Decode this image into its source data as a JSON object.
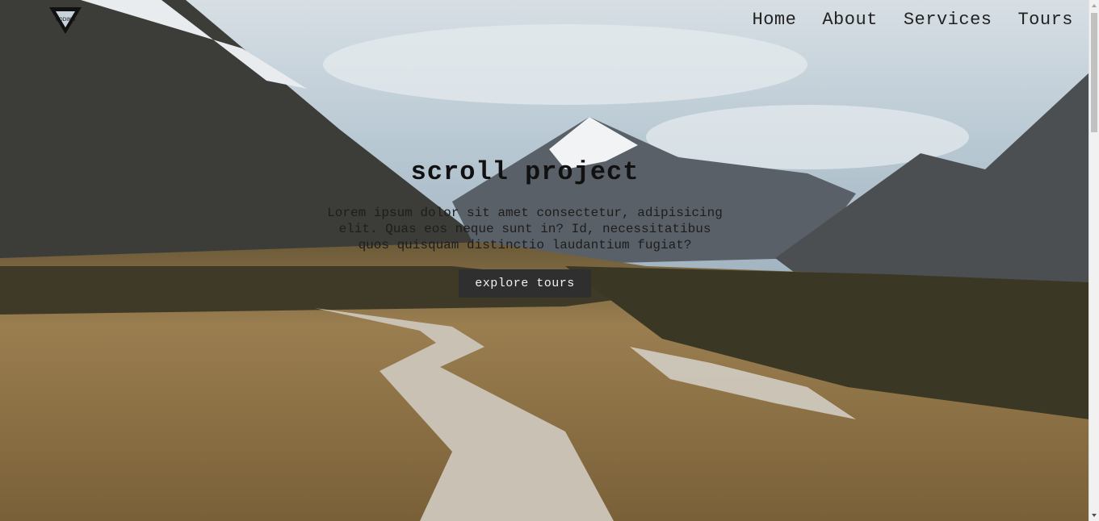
{
  "nav": {
    "logo_icon": "coding-addict-logo",
    "links": [
      {
        "label": "Home"
      },
      {
        "label": "About"
      },
      {
        "label": "Services"
      },
      {
        "label": "Tours"
      }
    ]
  },
  "hero": {
    "background": "mountain-valley-boardwalk-photo",
    "title": "scroll project",
    "text": "Lorem ipsum dolor sit amet consectetur, adipisicing elit. Quas eos neque sunt in? Id, necessitatibus quos quisquam distinctio laudantium fugiat?",
    "button_label": "explore tours"
  },
  "colors": {
    "button_bg": "#2f2f2f",
    "button_text": "#f2f2f2",
    "text_dark": "#111111"
  }
}
